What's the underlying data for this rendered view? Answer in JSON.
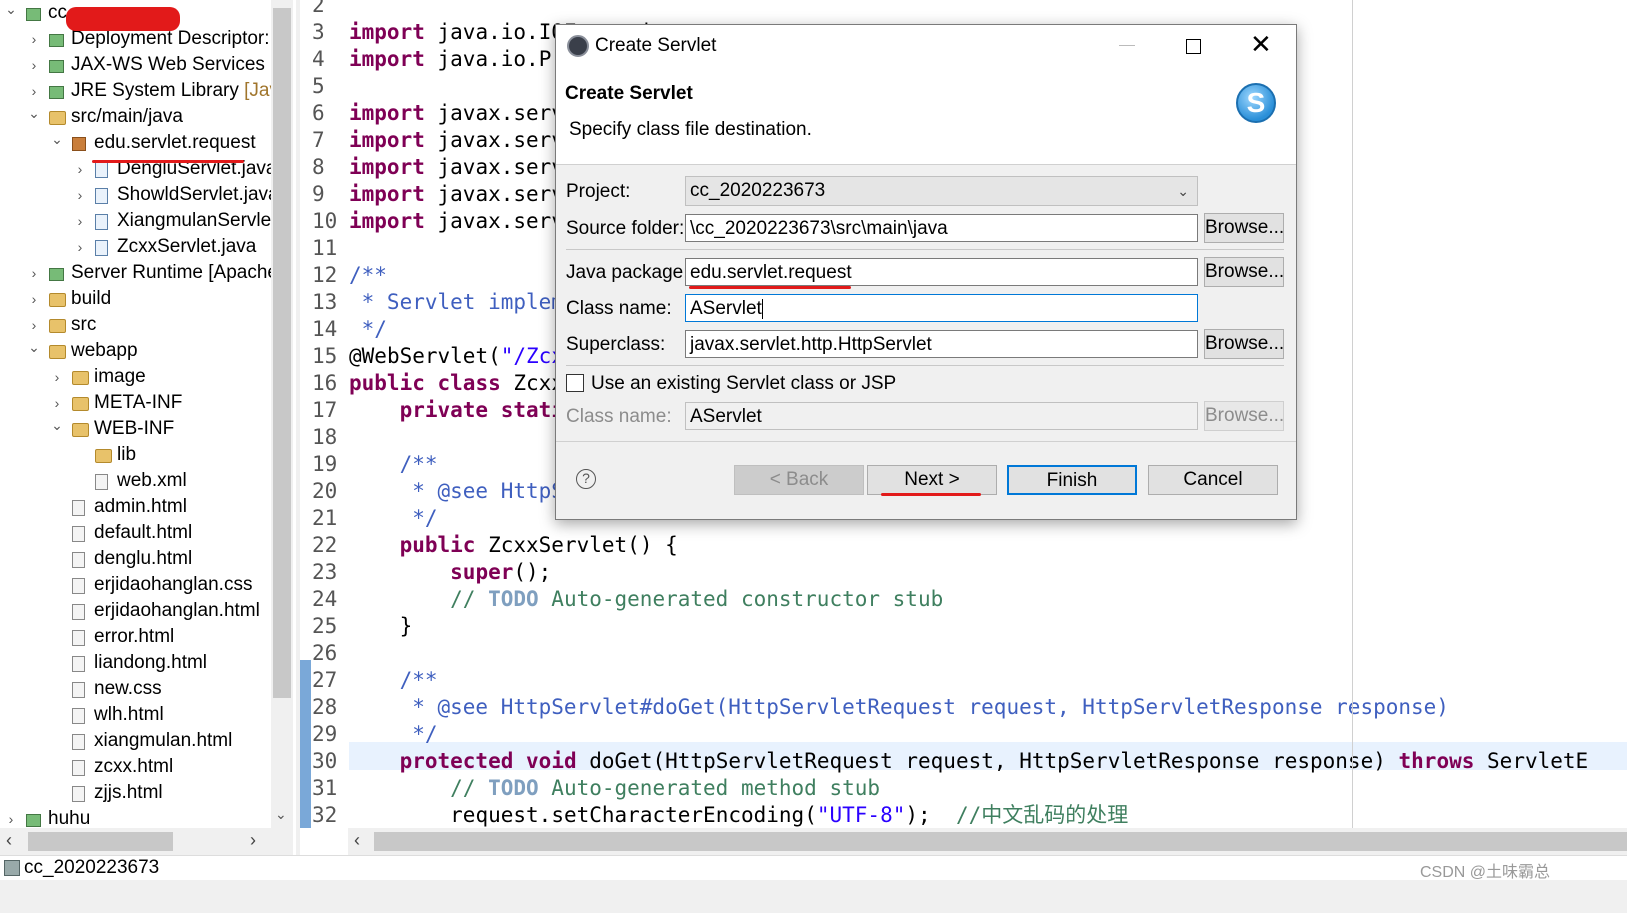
{
  "explorer": {
    "root_label": "cc_",
    "items": [
      {
        "label": "Deployment Descriptor:",
        "icon": "deployment-descriptor-icon"
      },
      {
        "label": "JAX-WS Web Services",
        "icon": "web-services-icon"
      },
      {
        "label": "JRE System Library ",
        "suffix": "[Java",
        "icon": "library-icon"
      },
      {
        "label": "src/main/java",
        "icon": "source-folder-icon"
      },
      {
        "label": "edu.servlet.request",
        "icon": "package-icon"
      },
      {
        "label": "DengluServlet.java",
        "icon": "java-file-icon"
      },
      {
        "label": "ShowldServlet.java",
        "icon": "java-file-icon"
      },
      {
        "label": "XiangmulanServlet",
        "icon": "java-file-icon"
      },
      {
        "label": "ZcxxServlet.java",
        "icon": "java-file-icon"
      },
      {
        "label": "Server Runtime [Apache",
        "icon": "library-icon"
      },
      {
        "label": "build",
        "icon": "folder-icon"
      },
      {
        "label": "src",
        "icon": "folder-icon"
      },
      {
        "label": "webapp",
        "icon": "folder-icon"
      },
      {
        "label": "image",
        "icon": "folder-icon"
      },
      {
        "label": "META-INF",
        "icon": "folder-icon"
      },
      {
        "label": "WEB-INF",
        "icon": "folder-icon"
      },
      {
        "label": "lib",
        "icon": "folder-icon"
      },
      {
        "label": "web.xml",
        "icon": "xml-file-icon"
      },
      {
        "label": "admin.html",
        "icon": "file-icon"
      },
      {
        "label": "default.html",
        "icon": "file-icon"
      },
      {
        "label": "denglu.html",
        "icon": "file-icon"
      },
      {
        "label": "erjidaohanglan.css",
        "icon": "file-icon"
      },
      {
        "label": "erjidaohanglan.html",
        "icon": "file-icon"
      },
      {
        "label": "error.html",
        "icon": "file-icon"
      },
      {
        "label": "liandong.html",
        "icon": "file-icon"
      },
      {
        "label": "new.css",
        "icon": "file-icon"
      },
      {
        "label": "wlh.html",
        "icon": "file-icon"
      },
      {
        "label": "xiangmulan.html",
        "icon": "file-icon"
      },
      {
        "label": "zcxx.html",
        "icon": "file-icon"
      },
      {
        "label": "zjjs.html",
        "icon": "file-icon"
      },
      {
        "label": "huhu",
        "icon": "project-icon"
      }
    ]
  },
  "editor": {
    "line_numbers": [
      "2",
      "3",
      "4",
      "5",
      "6",
      "7",
      "8",
      "9",
      "10",
      "11",
      "12",
      "13",
      "14",
      "15",
      "16",
      "17",
      "18",
      "19",
      "20",
      "21",
      "22",
      "23",
      "24",
      "25",
      "26",
      "27",
      "28",
      "29",
      "30",
      "31",
      "32"
    ],
    "lines": [
      {
        "k": "",
        "t": ""
      },
      {
        "k": "import ",
        "t": "java.io.IOException;"
      },
      {
        "k": "import ",
        "t": "java.io.PrintWriter;"
      },
      {
        "k": "",
        "t": ""
      },
      {
        "k": "import ",
        "t": "javax.servlet.ServletException;"
      },
      {
        "k": "import ",
        "t": "javax.servlet.annotation.WebServlet;"
      },
      {
        "k": "import ",
        "t": "javax.servlet.http.HttpServlet;"
      },
      {
        "k": "import ",
        "t": "javax.servlet.http.HttpServletRequest;"
      },
      {
        "k": "import ",
        "t": "javax.servlet.http.HttpServletResponse;"
      },
      {
        "k": "",
        "t": ""
      },
      {
        "k": "",
        "t": "/**"
      },
      {
        "k": "",
        "t": " * Servlet implementation class ZcxxServlet"
      },
      {
        "k": "",
        "t": " */"
      },
      {
        "k": "",
        "t": "@WebServlet(\"/ZcxxServlet\")"
      },
      {
        "k": "public class ",
        "t": "ZcxxServlet extends HttpServlet {"
      },
      {
        "k": "    private static ",
        "t": "final long serialVersionUID = 1L;"
      },
      {
        "k": "",
        "t": ""
      },
      {
        "k": "",
        "t": "    /**"
      },
      {
        "k": "",
        "t": "     * @see HttpServlet#HttpServlet()"
      },
      {
        "k": "",
        "t": "     */"
      },
      {
        "k": "    public ",
        "t": "ZcxxServlet() {"
      },
      {
        "k": "        super",
        "t": "();"
      },
      {
        "k": "",
        "t": "        // TODO Auto-generated constructor stub"
      },
      {
        "k": "",
        "t": "    }"
      },
      {
        "k": "",
        "t": ""
      },
      {
        "k": "",
        "t": "    /**"
      },
      {
        "k": "",
        "t": "     * @see HttpServlet#doGet(HttpServletRequest request, HttpServletResponse response)"
      },
      {
        "k": "",
        "t": "     */"
      },
      {
        "k": "    protected void ",
        "t": "doGet(HttpServletRequest request, HttpServletResponse response) throws ServletE"
      },
      {
        "k": "",
        "t": "        // TODO Auto-generated method stub"
      },
      {
        "k": "",
        "t": "        request.setCharacterEncoding(\"UTF-8\");  //中文乱码的处理"
      }
    ]
  },
  "dialog": {
    "title": "Create Servlet",
    "banner_title": "Create Servlet",
    "banner_subtitle": "Specify class file destination.",
    "project_label": "Project:",
    "project_value": "cc_2020223673",
    "source_folder_label": "Source folder:",
    "source_folder_value": "\\cc_2020223673\\src\\main\\java",
    "java_package_label": "Java package:",
    "java_package_value": "edu.servlet.request",
    "class_name_label": "Class name:",
    "class_name_value": "AServlet",
    "superclass_label": "Superclass:",
    "superclass_value": "javax.servlet.http.HttpServlet",
    "existing_checkbox_label": "Use an existing Servlet class or JSP",
    "existing_class_label": "Class name:",
    "existing_class_value": "AServlet",
    "browse": "Browse...",
    "back": "< Back",
    "next": "Next >",
    "finish": "Finish",
    "cancel": "Cancel",
    "help": "?"
  },
  "status": {
    "project": "cc_2020223673",
    "watermark": "CSDN @土味霸总"
  },
  "colors": {
    "annotation_red": "#e21a1a",
    "keyword": "#7f0055",
    "comment": "#3f7f5f",
    "javadoc": "#3f5fbf",
    "string": "#2a00ff"
  }
}
